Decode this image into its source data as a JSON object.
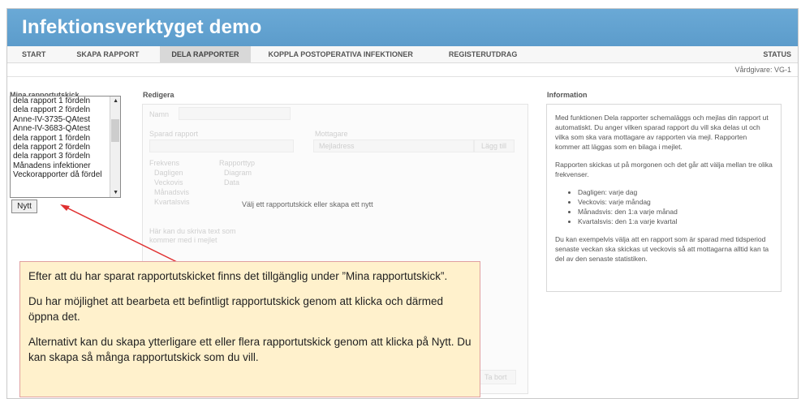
{
  "app": {
    "title": "Infektionsverktyget demo"
  },
  "nav": {
    "tabs": [
      "START",
      "SKAPA RAPPORT",
      "DELA RAPPORTER",
      "KOPPLA POSTOPERATIVA INFEKTIONER",
      "REGISTERUTDRAG"
    ],
    "active": "DELA RAPPORTER",
    "status": "STATUS"
  },
  "provider": "Vårdgivare: VG-1",
  "left": {
    "title": "Mina rapportutskick",
    "items": [
      "dela rapport 1 fördeln",
      "dela rapport 2 fördeln",
      "Anne-IV-3735-QAtest",
      "Anne-IV-3683-QAtest",
      "dela rapport 1 fördeln",
      "dela rapport 2 fördeln",
      "dela rapport 3 fördeln",
      "Månadens infektioner",
      "Veckorapporter då fördel"
    ],
    "new_button": "Nytt"
  },
  "edit": {
    "title": "Redigera",
    "name_label": "Namn",
    "saved_report_label": "Sparad rapport",
    "recipients_label": "Mottagare",
    "recipients_placeholder": "Mejladress",
    "add_button": "Lägg till",
    "frequency_label": "Frekvens",
    "frequency_options": [
      "Dagligen",
      "Veckovis",
      "Månadsvis",
      "Kvartalsvis"
    ],
    "report_type_label": "Rapporttyp",
    "report_type_options": [
      "Diagram",
      "Data"
    ],
    "text_label": "Här kan du skriva text som kommer med i mejlet",
    "remove_button": "Ta bort",
    "empty_message": "Välj ett rapportutskick eller skapa ett nytt"
  },
  "info": {
    "title": "Information",
    "p1": "Med funktionen Dela rapporter schemaläggs och mejlas din rapport ut automatiskt. Du anger vilken sparad rapport du vill ska delas ut och vilka som ska vara mottagare av rapporten via mejl. Rapporten kommer att läggas som en bilaga i mejlet.",
    "p2": "Rapporten skickas ut på morgonen och det går att välja mellan tre olika frekvenser.",
    "bullets": [
      "Dagligen: varje dag",
      "Veckovis: varje måndag",
      "Månadsvis: den 1:a varje månad",
      "Kvartalsvis: den 1:a varje kvartal"
    ],
    "p3": "Du kan exempelvis välja att en rapport som är sparad med tidsperiod senaste veckan ska skickas ut veckovis så att mottagarna alltid kan ta del av den senaste statistiken."
  },
  "callout": {
    "p1": "Efter att du har sparat rapportutskicket finns det tillgänglig under ”Mina rapportutskick”.",
    "p2": "Du har möjlighet att bearbeta ett befintligt rapportutskick genom att klicka och därmed öppna det.",
    "p3": "Alternativt kan du skapa ytterligare ett eller flera rapportutskick genom att klicka på Nytt. Du kan skapa så många rapportutskick som du vill."
  },
  "colors": {
    "header": "#5c9ccb",
    "callout_bg": "#fff1cc",
    "arrow": "#e03030"
  }
}
